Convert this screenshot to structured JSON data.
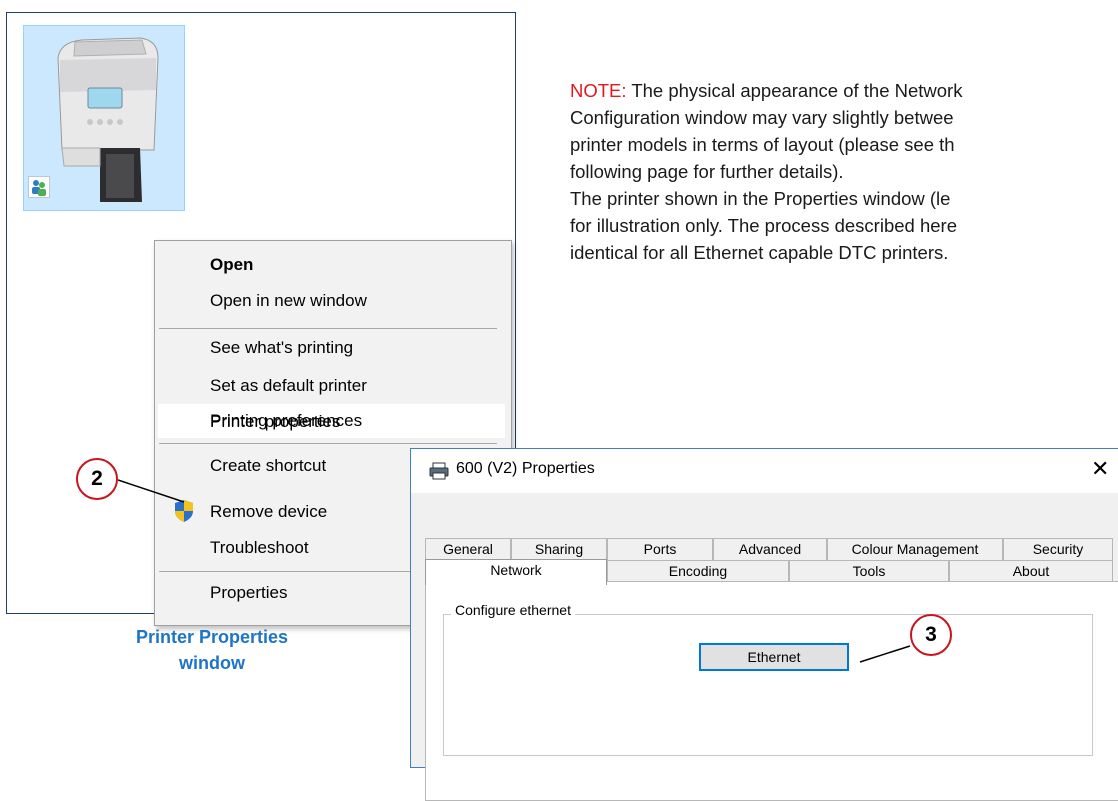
{
  "menu": {
    "items": [
      {
        "label": "Open",
        "bold": true
      },
      {
        "label": "Open in new window"
      },
      {
        "label": "See what's printing"
      },
      {
        "label": "Set as default printer"
      },
      {
        "label": "Printing preferences"
      },
      {
        "label": "Printer properties",
        "highlighted": true
      },
      {
        "label": "Create shortcut"
      },
      {
        "label": "Remove device",
        "icon": "shield-icon"
      },
      {
        "label": "Troubleshoot"
      },
      {
        "label": "Properties"
      }
    ]
  },
  "callouts": {
    "step2": "2",
    "step3": "3"
  },
  "caption": {
    "line1": "Printer Properties",
    "line2": "window"
  },
  "note": {
    "prefix": "NOTE:",
    "line1": "  The physical appearance of the Network",
    "line2": "Configuration window may vary slightly betwee",
    "line3": "printer models in terms of layout (please see th",
    "line4": "following page for further details).",
    "line5": "The printer shown in the Properties window (le",
    "line6": "for illustration only. The process described here",
    "line7": "identical for all Ethernet capable DTC printers."
  },
  "window": {
    "title": "600 (V2) Properties",
    "close": "✕",
    "tabs_row1": [
      "General",
      "Sharing",
      "Ports",
      "Advanced",
      "Colour Management",
      "Security"
    ],
    "tabs_row2": [
      "Network",
      "Encoding",
      "Tools",
      "About"
    ],
    "active_tab": "Network",
    "group_label": "Configure ethernet",
    "button_label": "Ethernet"
  },
  "colors": {
    "accent": "#0078d7",
    "callout": "#c8141e",
    "caption": "#1e74c6",
    "note_red": "#e3171e"
  }
}
